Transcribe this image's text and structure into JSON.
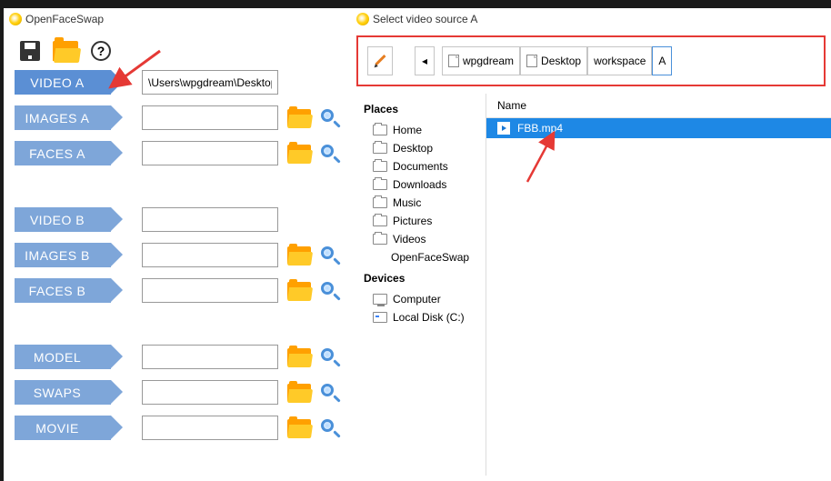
{
  "main": {
    "title": "OpenFaceSwap",
    "help_glyph": "?",
    "rows": [
      {
        "label": "VIDEO A",
        "value": "\\Users\\wpgdream\\Desktop\\",
        "folder": false,
        "search": false,
        "active": true
      },
      {
        "label": "IMAGES A",
        "value": "",
        "folder": true,
        "search": true,
        "active": false
      },
      {
        "label": "FACES A",
        "value": "",
        "folder": true,
        "search": true,
        "active": false
      }
    ],
    "rows2": [
      {
        "label": "VIDEO B",
        "value": "",
        "folder": false,
        "search": false,
        "active": false
      },
      {
        "label": "IMAGES B",
        "value": "",
        "folder": true,
        "search": true,
        "active": false
      },
      {
        "label": "FACES B",
        "value": "",
        "folder": true,
        "search": true,
        "active": false
      }
    ],
    "rows3": [
      {
        "label": "MODEL",
        "value": "",
        "folder": true,
        "search": true,
        "active": false
      },
      {
        "label": "SWAPS",
        "value": "",
        "folder": true,
        "search": true,
        "active": false
      },
      {
        "label": "MOVIE",
        "value": "",
        "folder": true,
        "search": true,
        "active": false
      }
    ]
  },
  "dialog": {
    "title": "Select video source A",
    "nav_back_glyph": "◂",
    "breadcrumbs": [
      {
        "label": "wpgdream",
        "icon": true
      },
      {
        "label": "Desktop",
        "icon": true
      },
      {
        "label": "workspace",
        "icon": false
      },
      {
        "label": "A",
        "icon": false,
        "current": true
      }
    ],
    "places_label": "Places",
    "places": [
      {
        "label": "Home",
        "type": "folder"
      },
      {
        "label": "Desktop",
        "type": "folder"
      },
      {
        "label": "Documents",
        "type": "folder"
      },
      {
        "label": "Downloads",
        "type": "folder"
      },
      {
        "label": "Music",
        "type": "folder"
      },
      {
        "label": "Pictures",
        "type": "folder"
      },
      {
        "label": "Videos",
        "type": "folder"
      },
      {
        "label": "OpenFaceSwap",
        "type": "nested"
      }
    ],
    "devices_label": "Devices",
    "devices": [
      {
        "label": "Computer",
        "type": "computer"
      },
      {
        "label": "Local Disk (C:)",
        "type": "drive"
      }
    ],
    "file_header": "Name",
    "files": [
      {
        "name": "FBB.mp4",
        "selected": true
      }
    ]
  }
}
